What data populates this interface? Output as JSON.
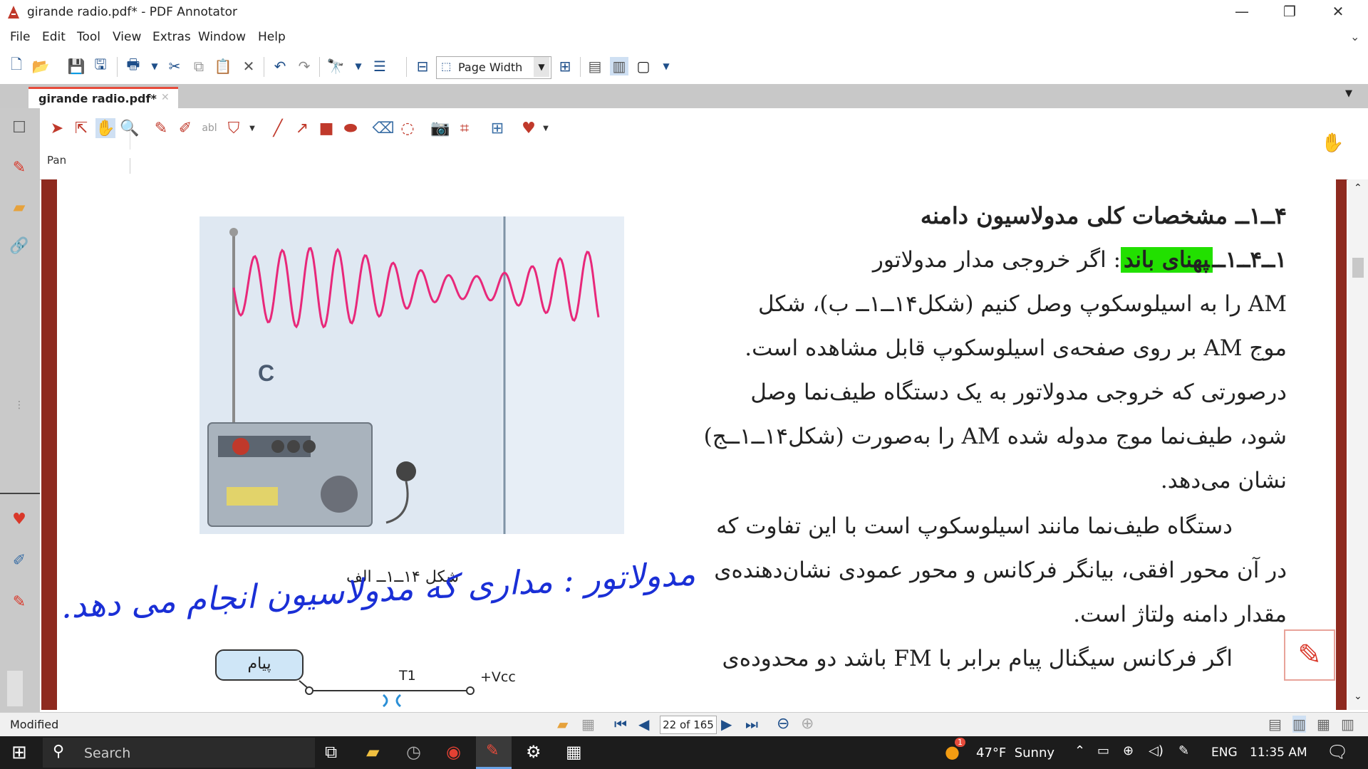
{
  "window": {
    "title": "girande radio.pdf* - PDF Annotator",
    "minimize": "—",
    "restore": "❐",
    "close": "✕"
  },
  "menu": {
    "items": [
      "File",
      "Edit",
      "Tool",
      "View",
      "Extras",
      "Window",
      "Help"
    ]
  },
  "toolbar": {
    "zoom_value": "Page Width"
  },
  "tab": {
    "label": "girande radio.pdf*"
  },
  "annotation_toolbar": {
    "current_tool_label": "Pan"
  },
  "figure": {
    "radio_letter": "C",
    "caption": "شکل ۱۴ــ۱ــ الف",
    "diagram_box_label": "پیام",
    "t1_label": "T1",
    "vcc_label": "+Vcc"
  },
  "handwriting": {
    "note": "مدولاتور : مداری که مدولاسیون انجام می دهد."
  },
  "document": {
    "heading": "۴ــ۱ــ مشخصات کلی مدولاسیون دامنه",
    "subheading_number": "۱ــ۴ــ۱ــ",
    "subheading_highlight": "پهنای باند",
    "lines": [
      ": اگر خروجی مدار مدولاتور",
      "AM را به اسیلوسکوپ وصل کنیم (شکل۱۴ــ۱ــ ب)، شکل",
      "موج AM بر روی صفحه‌ی اسیلوسکوپ قابل مشاهده است.",
      "درصورتی که خروجی مدولاتور به یک دستگاه طیف‌نما وصل",
      "شود، طیف‌نما موج مدوله شده AM را به‌صورت (شکل۱۴ــ۱ــج)",
      "نشان می‌دهد.",
      "دستگاه طیف‌نما مانند اسیلوسکوپ است با این تفاوت که",
      "در آن محور افقی، بیانگر فرکانس و محور عمودی نشان‌دهنده‌ی",
      "مقدار دامنه ولتاژ است.",
      "اگر فرکانس سیگنال پیام برابر با FM باشد دو محدوده‌ی"
    ]
  },
  "status": {
    "state": "Modified",
    "page_indicator": "22 of 165"
  },
  "taskbar": {
    "search_placeholder": "Search",
    "weather": "47°F  Sunny",
    "weather_badge": "1",
    "language": "ENG",
    "time": "11:35 AM"
  },
  "colors": {
    "highlight": "#22e000",
    "page_border": "#8e2a1f",
    "ink": "#1a2fd6",
    "wave": "#e8287a",
    "accent": "#e74c3c"
  }
}
